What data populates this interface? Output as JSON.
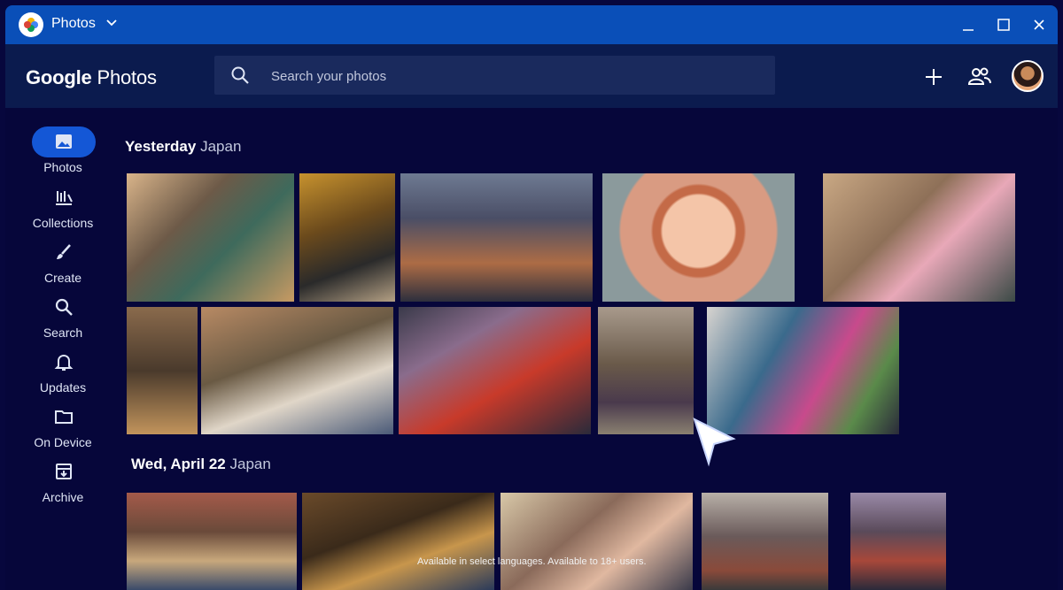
{
  "titlebar": {
    "app_name": "Photos"
  },
  "header": {
    "brand_google": "Google",
    "brand_photos": "Photos",
    "search_placeholder": "Search your photos"
  },
  "nav": [
    {
      "label": "Photos",
      "icon": "image-icon",
      "active": true
    },
    {
      "label": "Collections",
      "icon": "collections-icon"
    },
    {
      "label": "Create",
      "icon": "brush-icon"
    },
    {
      "label": "Search",
      "icon": "search-icon"
    },
    {
      "label": "Updates",
      "icon": "bell-icon"
    },
    {
      "label": "On Device",
      "icon": "folder-icon"
    },
    {
      "label": "Archive",
      "icon": "archive-icon"
    }
  ],
  "sections": [
    {
      "date": "Yesterday",
      "place": "Japan"
    },
    {
      "date": "Wed, April 22",
      "place": "Japan"
    }
  ],
  "footnote": "Available in select languages. Available to 18+ users.",
  "colors": {
    "titlebar": "#0a4fb8",
    "header": "#0b1b4e",
    "background": "#06063a",
    "accent": "#1457d6"
  }
}
